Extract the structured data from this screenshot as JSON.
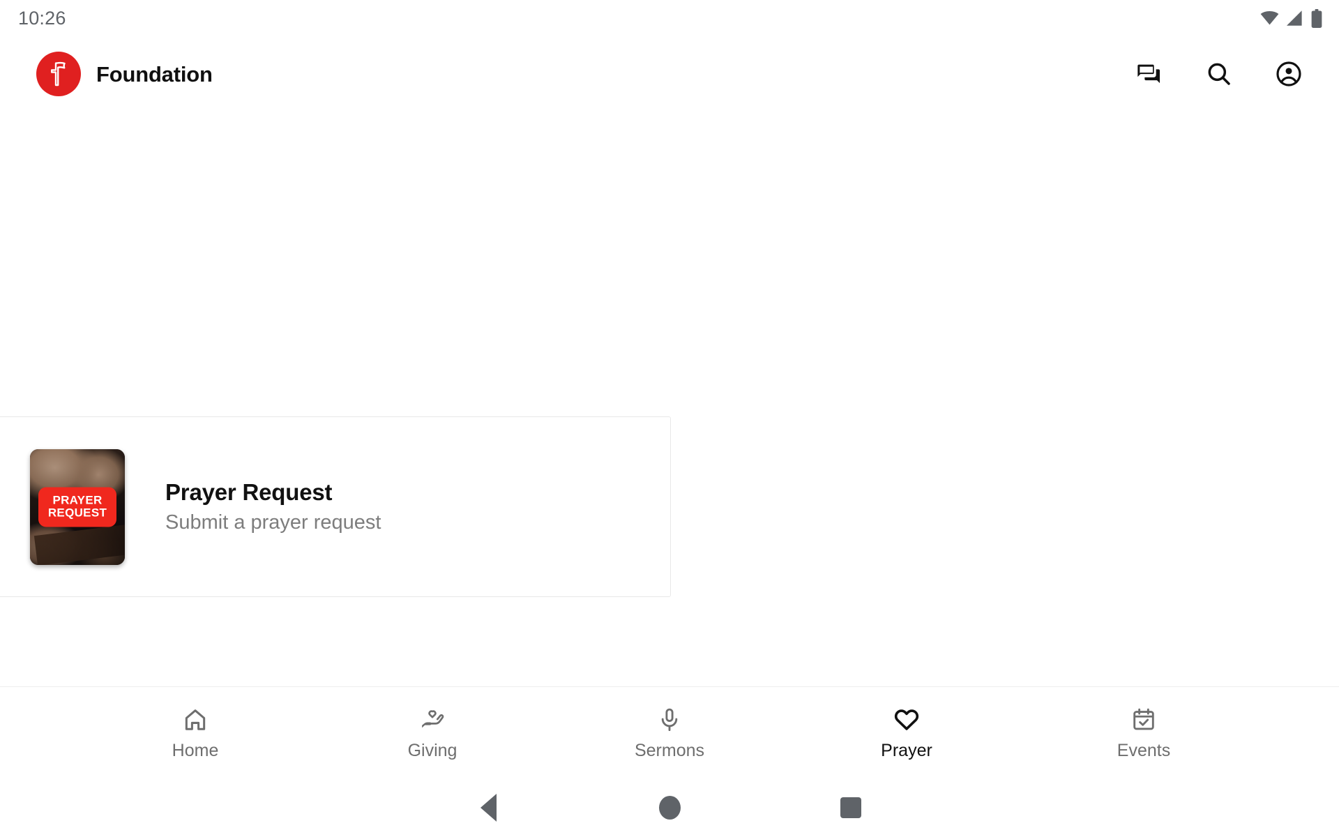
{
  "status_bar": {
    "time": "10:26",
    "icons": [
      {
        "name": "wifi-icon"
      },
      {
        "name": "cellular-signal-icon"
      },
      {
        "name": "battery-icon"
      }
    ]
  },
  "header": {
    "logo_icon": "cross-logo-icon",
    "title": "Foundation",
    "brand_color": "#e02020",
    "actions": [
      {
        "name": "messages-icon",
        "label": "Messages"
      },
      {
        "name": "search-icon",
        "label": "Search"
      },
      {
        "name": "account-circle-icon",
        "label": "Account"
      }
    ]
  },
  "main": {
    "card": {
      "title": "Prayer Request",
      "subtitle": "Submit a prayer request",
      "thumbnail": {
        "name": "prayer-request-thumbnail",
        "badge_line_1": "PRAYER",
        "badge_line_2": "REQUEST",
        "badge_color": "#f0281e"
      }
    }
  },
  "bottom_nav": {
    "items": [
      {
        "label": "Home",
        "icon": "home-icon",
        "active": false
      },
      {
        "label": "Giving",
        "icon": "volunteer-hand-heart-icon",
        "active": false
      },
      {
        "label": "Sermons",
        "icon": "microphone-icon",
        "active": false
      },
      {
        "label": "Prayer",
        "icon": "heart-icon",
        "active": true
      },
      {
        "label": "Events",
        "icon": "calendar-check-icon",
        "active": false
      }
    ],
    "active_color": "#111111",
    "inactive_color": "#6e6e6e"
  },
  "system_nav": {
    "buttons": [
      {
        "name": "android-back-button",
        "label": "Back"
      },
      {
        "name": "android-home-button",
        "label": "Home"
      },
      {
        "name": "android-recents-button",
        "label": "Recents"
      }
    ]
  }
}
